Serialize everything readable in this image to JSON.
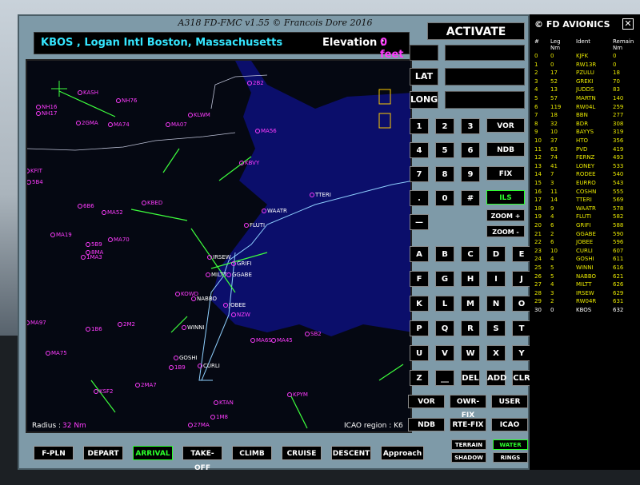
{
  "window": {
    "title": "A318 FD-FMC v1.55 © Francois Dore 2016",
    "brand": "© FD AVIONICS",
    "close_glyph": "✕"
  },
  "airport": {
    "name": "KBOS , Logan Intl  Boston, Massachusetts",
    "elevation_label": "Elevation :",
    "elevation_value": "0 feet"
  },
  "controls": {
    "activate": "ACTIVATE",
    "lat_label": "LAT",
    "long_label": "LONG"
  },
  "keypad": {
    "digits": [
      "1",
      "2",
      "3",
      "4",
      "5",
      "6",
      "7",
      "8",
      "9",
      ".",
      "0",
      "#",
      "—"
    ],
    "nav_buttons": [
      "VOR",
      "NDB",
      "FIX",
      "ILS"
    ],
    "zoom_in": "ZOOM +",
    "zoom_out": "ZOOM -",
    "letters": [
      "A",
      "B",
      "C",
      "D",
      "E",
      "F",
      "G",
      "H",
      "I",
      "J",
      "K",
      "L",
      "M",
      "N",
      "O",
      "P",
      "Q",
      "R",
      "S",
      "T",
      "U",
      "V",
      "W",
      "X",
      "Y",
      "Z",
      "__",
      "DEL",
      "ADD",
      "CLR"
    ]
  },
  "lookup": {
    "row1": [
      "VOR",
      "OWR-FIX",
      "USER"
    ],
    "row2": [
      "NDB",
      "RTE-FIX",
      "ICAO"
    ]
  },
  "toggles": {
    "terrain": "TERRAIN",
    "water": "WATER",
    "shadow": "SHADOW",
    "rings": "RINGS"
  },
  "nav": [
    "F-PLN",
    "DEPART",
    "ARRIVAL",
    "TAKE-OFF",
    "CLIMB",
    "CRUISE",
    "DESCENT",
    "Approach"
  ],
  "active_nav": "ARRIVAL",
  "map": {
    "radius_label": "Radius :",
    "radius_value": "32 Nm",
    "icao_region": "ICAO region : K6"
  },
  "flightplan": {
    "headers": [
      "#",
      "Leg\nNm",
      "Ident",
      "Remain\nNm"
    ],
    "rows": [
      [
        "0",
        "0",
        "KJFK",
        "0"
      ],
      [
        "1",
        "0",
        "RW13R",
        "0"
      ],
      [
        "2",
        "17",
        "PZULU",
        "18"
      ],
      [
        "3",
        "52",
        "GREKI",
        "70"
      ],
      [
        "4",
        "13",
        "JUDDS",
        "83"
      ],
      [
        "5",
        "57",
        "MARTN",
        "140"
      ],
      [
        "6",
        "119",
        "RW04L",
        "259"
      ],
      [
        "7",
        "18",
        "BBN",
        "277"
      ],
      [
        "8",
        "32",
        "BDR",
        "308"
      ],
      [
        "9",
        "10",
        "BAYYS",
        "319"
      ],
      [
        "10",
        "37",
        "HTO",
        "356"
      ],
      [
        "11",
        "63",
        "PVD",
        "419"
      ],
      [
        "12",
        "74",
        "FERNZ",
        "493"
      ],
      [
        "13",
        "41",
        "LONEY",
        "533"
      ],
      [
        "14",
        "7",
        "RODEE",
        "540"
      ],
      [
        "15",
        "3",
        "EURRO",
        "543"
      ],
      [
        "16",
        "11",
        "COSHN",
        "555"
      ],
      [
        "17",
        "14",
        "TTERI",
        "569"
      ],
      [
        "18",
        "9",
        "WAATR",
        "578"
      ],
      [
        "19",
        "4",
        "FLUTI",
        "582"
      ],
      [
        "20",
        "6",
        "GRIFI",
        "588"
      ],
      [
        "21",
        "2",
        "GGABE",
        "590"
      ],
      [
        "22",
        "6",
        "JOBEE",
        "596"
      ],
      [
        "23",
        "10",
        "CURLI",
        "607"
      ],
      [
        "24",
        "4",
        "GOSHI",
        "611"
      ],
      [
        "25",
        "5",
        "WINNI",
        "616"
      ],
      [
        "26",
        "5",
        "NABBO",
        "621"
      ],
      [
        "27",
        "4",
        "MILTT",
        "626"
      ],
      [
        "28",
        "3",
        "IRSEW",
        "629"
      ],
      [
        "29",
        "2",
        "RW04R",
        "631"
      ],
      [
        "30",
        "0",
        "KBOS",
        "632"
      ]
    ]
  },
  "map_labels": {
    "fixes": [
      "KASH",
      "NH76",
      "2B2",
      "NH16",
      "NH17",
      "2GMA",
      "MA74",
      "MA07",
      "KLWM",
      "MA56",
      "KBVY",
      "KFIT",
      "5B4",
      "6B6",
      "MA52",
      "KBED",
      "TTERI",
      "WAATR",
      "FLUTI",
      "MA19",
      "MA70",
      "5B9",
      "8MA",
      "1MA3",
      "IRSEW",
      "GRIFI",
      "MILTT",
      "GGABE",
      "KOWD",
      "NABBO",
      "JOBEE",
      "NZW",
      "MA97",
      "1B6",
      "2M2",
      "WINNI",
      "MA6S",
      "MA45",
      "SB2",
      "MA75",
      "GOSHI",
      "1B9",
      "CURLI",
      "2MA7",
      "KSF2",
      "KTAN",
      "1M8",
      "27MA",
      "KPYM"
    ]
  }
}
